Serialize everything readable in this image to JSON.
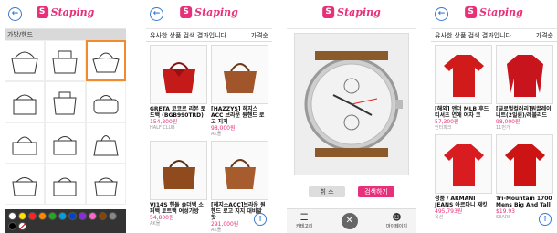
{
  "brand": {
    "name": "Staping",
    "accent": "#e8307a",
    "link": "#3a7bd5"
  },
  "screen1": {
    "category_label": "가방/핸드",
    "palette": [
      "#ffffff",
      "#ffe000",
      "#ff2222",
      "#ff8800",
      "#22aa22",
      "#00a0e0",
      "#0044cc",
      "#8a2be2",
      "#ff66cc",
      "#884400",
      "#888888",
      "#000000",
      "#ffffff"
    ]
  },
  "screen2": {
    "header": {
      "left": "유사한 상품 검색 결과입니다.",
      "right": "가격순"
    },
    "items": [
      {
        "title": "GRETA 코코르 리본 토드백 (BGB990TRD)",
        "price": "154,800원",
        "shop": "HALF CLUB"
      },
      {
        "title": "[HAZZYS] 헤지스ACC 브라운 원핸드 로고 지지",
        "price": "98,000원",
        "shop": "AK몰"
      },
      {
        "title": "VJ14S 핸들 숄더백 소 퍼백 토트백 여성가방",
        "price": "54,800원",
        "shop": "AK몰"
      },
      {
        "title": "[헤지스ACC]브라운 원핸드 로고 지지 대비밭 핫",
        "price": "291,000원",
        "shop": "AK몰"
      }
    ]
  },
  "screen3": {
    "cancel_label": "취 소",
    "search_label": "검색하기",
    "nav": {
      "left": "카테고리",
      "right": "마이페이지"
    }
  },
  "screen4": {
    "header": {
      "left": "유사한 상품 검색 결과입니다.",
      "right": "가격순"
    },
    "items": [
      {
        "title": "[해외] 앤더 MLB 후드 티셔츠 연애 여자 코",
        "price": "57,300원",
        "shop": "인터파크"
      },
      {
        "title": "[글로벌컬러리]원끌레이니트(2일퀸)/레블리드",
        "price": "98,000원",
        "shop": "11번가"
      },
      {
        "title": "정품 / ARMANI JEANS 아르마니 재킷",
        "price": "495,793원",
        "shop": "옥션"
      },
      {
        "title": "Tri-Mountain 1700 Mens Big And Tall",
        "price": "$19.93",
        "shop": "SEARS"
      }
    ]
  }
}
